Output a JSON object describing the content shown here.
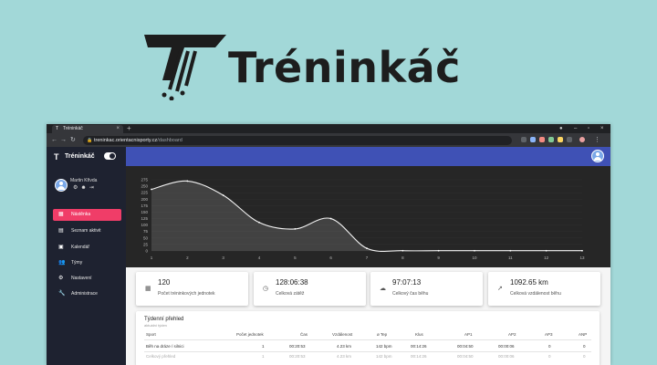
{
  "logo": {
    "text": "Tréninkáč",
    "icon": "running-t-logo-icon"
  },
  "browser": {
    "tab_title": "Tréninkáč",
    "url_host": "treninkac.orientacnisporty.cz",
    "url_path": "/dashboard"
  },
  "sidebar": {
    "brand": "Tréninkáč",
    "user_name": "Martin Křivda",
    "items": [
      {
        "label": "Nástěnka",
        "icon": "dashboard-icon",
        "active": true
      },
      {
        "label": "Seznam aktivit",
        "icon": "list-icon",
        "active": false
      },
      {
        "label": "Kalendář",
        "icon": "calendar-icon",
        "active": false
      },
      {
        "label": "Týmy",
        "icon": "team-icon",
        "active": false
      },
      {
        "label": "Nastavení",
        "icon": "gear-icon",
        "active": false
      },
      {
        "label": "Administrace",
        "icon": "wrench-icon",
        "active": false
      }
    ]
  },
  "chart_data": {
    "type": "area",
    "x": [
      1,
      2,
      3,
      4,
      5,
      6,
      7,
      8,
      9,
      10,
      11,
      12,
      13
    ],
    "y": [
      238,
      270,
      215,
      110,
      85,
      125,
      10,
      1,
      1,
      1,
      1,
      1,
      1
    ],
    "yticks": [
      0,
      25,
      50,
      75,
      100,
      125,
      150,
      175,
      200,
      225,
      250,
      275
    ],
    "xticks": [
      "1",
      "2",
      "3",
      "4",
      "5",
      "6",
      "7",
      "8",
      "9",
      "10",
      "11",
      "12",
      "13"
    ],
    "ylim": [
      0,
      275
    ],
    "xlabel": "",
    "ylabel": "",
    "title": ""
  },
  "cards": [
    {
      "value": "120",
      "label": "Počet tréninkových jednotek",
      "icon": "activity-icon"
    },
    {
      "value": "128:06:38",
      "label": "Celková zátěž",
      "icon": "timer-icon"
    },
    {
      "value": "97:07:13",
      "label": "Celkový čas běhu",
      "icon": "clock-icon"
    },
    {
      "value": "1092.65 km",
      "label": "Celková vzdálenost běhu",
      "icon": "trend-icon"
    }
  ],
  "weekly": {
    "title": "Týdenní přehled",
    "subtitle": "aktuální týden",
    "headers": [
      "Sport",
      "Počet jednotek",
      "Čas",
      "Vzdálenost",
      "ø Tep",
      "Klus",
      "AP1",
      "AP2",
      "AP3",
      "ANP"
    ],
    "rows": [
      [
        "Běh na dráze / silnici",
        "1",
        "00:20:53",
        "4.23 km",
        "142 bpm",
        "00:14:26",
        "00:04:50",
        "00:00:06",
        "0",
        "0"
      ],
      [
        "Celkový přehled",
        "1",
        "00:20:53",
        "4.23 km",
        "142 bpm",
        "00:14:26",
        "00:04:50",
        "00:00:06",
        "0",
        "0"
      ]
    ]
  }
}
